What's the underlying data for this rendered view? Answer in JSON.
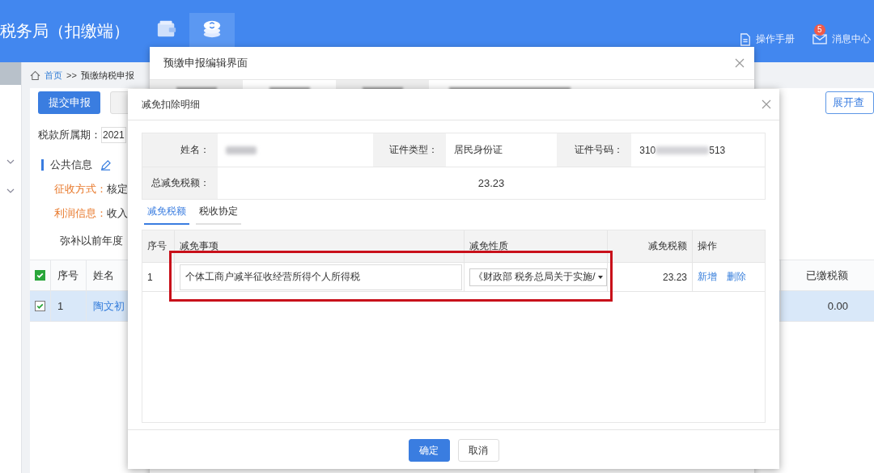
{
  "header": {
    "title": "税务局（扣缴端）",
    "nav": [
      {
        "kind": "wallet",
        "selected": false
      },
      {
        "kind": "coins",
        "selected": true
      }
    ],
    "links": [
      {
        "kind": "manual",
        "label": "操作手册"
      },
      {
        "kind": "messages",
        "label": "消息中心",
        "badge": "5"
      }
    ]
  },
  "breadcrumb": {
    "home": "首页",
    "separator": ">>",
    "current": "预缴纳税申报"
  },
  "toolbar": {
    "submit": "提交申报",
    "expand": "展开查"
  },
  "period": {
    "label": "税款所属期：",
    "value": "2021"
  },
  "section": "公共信息",
  "info": [
    {
      "label": "征收方式：",
      "value": "核定"
    },
    {
      "label": "利润信息：",
      "value": "收入"
    }
  ],
  "note": "弥补以前年度",
  "table": {
    "all_checked": true,
    "columns": [
      "序号",
      "姓名"
    ],
    "right_column": "已缴税额",
    "rows": [
      {
        "checked": true,
        "selected": true,
        "no": "1",
        "name": "陶文初",
        "paid": "0.00"
      }
    ]
  },
  "edit_dialog": {
    "title": "预缴申报编辑界面"
  },
  "detail_dialog": {
    "title": "减免扣除明细",
    "name_label": "姓名：",
    "id_type_label": "证件类型：",
    "id_type": "居民身份证",
    "id_no_label": "证件号码：",
    "id_no_start": "310",
    "id_no_end": "513",
    "total_label": "总减免税额：",
    "total": "23.23",
    "tabs": [
      {
        "label": "减免税额",
        "selected": true
      },
      {
        "label": "税收协定",
        "selected": false
      }
    ],
    "columns": [
      "序号",
      "减免事项",
      "减免性质",
      "减免税额",
      "操作"
    ],
    "rows": [
      {
        "no": "1",
        "item": "个体工商户减半征收经营所得个人所得税",
        "nature": "《财政部 税务总局关于实施/",
        "amount": "23.23",
        "actions": [
          "新增",
          "删除"
        ]
      }
    ],
    "buttons": [
      {
        "label": "确定",
        "kind": "primary"
      },
      {
        "label": "取消",
        "kind": "plain"
      }
    ]
  }
}
